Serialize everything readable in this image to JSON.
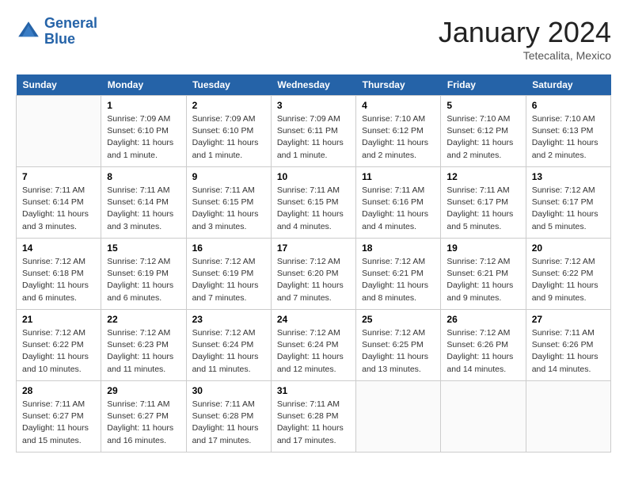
{
  "header": {
    "logo_line1": "General",
    "logo_line2": "Blue",
    "month": "January 2024",
    "location": "Tetecalita, Mexico"
  },
  "days_of_week": [
    "Sunday",
    "Monday",
    "Tuesday",
    "Wednesday",
    "Thursday",
    "Friday",
    "Saturday"
  ],
  "weeks": [
    [
      {
        "day": "",
        "info": ""
      },
      {
        "day": "1",
        "info": "Sunrise: 7:09 AM\nSunset: 6:10 PM\nDaylight: 11 hours\nand 1 minute."
      },
      {
        "day": "2",
        "info": "Sunrise: 7:09 AM\nSunset: 6:10 PM\nDaylight: 11 hours\nand 1 minute."
      },
      {
        "day": "3",
        "info": "Sunrise: 7:09 AM\nSunset: 6:11 PM\nDaylight: 11 hours\nand 1 minute."
      },
      {
        "day": "4",
        "info": "Sunrise: 7:10 AM\nSunset: 6:12 PM\nDaylight: 11 hours\nand 2 minutes."
      },
      {
        "day": "5",
        "info": "Sunrise: 7:10 AM\nSunset: 6:12 PM\nDaylight: 11 hours\nand 2 minutes."
      },
      {
        "day": "6",
        "info": "Sunrise: 7:10 AM\nSunset: 6:13 PM\nDaylight: 11 hours\nand 2 minutes."
      }
    ],
    [
      {
        "day": "7",
        "info": "Sunrise: 7:11 AM\nSunset: 6:14 PM\nDaylight: 11 hours\nand 3 minutes."
      },
      {
        "day": "8",
        "info": "Sunrise: 7:11 AM\nSunset: 6:14 PM\nDaylight: 11 hours\nand 3 minutes."
      },
      {
        "day": "9",
        "info": "Sunrise: 7:11 AM\nSunset: 6:15 PM\nDaylight: 11 hours\nand 3 minutes."
      },
      {
        "day": "10",
        "info": "Sunrise: 7:11 AM\nSunset: 6:15 PM\nDaylight: 11 hours\nand 4 minutes."
      },
      {
        "day": "11",
        "info": "Sunrise: 7:11 AM\nSunset: 6:16 PM\nDaylight: 11 hours\nand 4 minutes."
      },
      {
        "day": "12",
        "info": "Sunrise: 7:11 AM\nSunset: 6:17 PM\nDaylight: 11 hours\nand 5 minutes."
      },
      {
        "day": "13",
        "info": "Sunrise: 7:12 AM\nSunset: 6:17 PM\nDaylight: 11 hours\nand 5 minutes."
      }
    ],
    [
      {
        "day": "14",
        "info": "Sunrise: 7:12 AM\nSunset: 6:18 PM\nDaylight: 11 hours\nand 6 minutes."
      },
      {
        "day": "15",
        "info": "Sunrise: 7:12 AM\nSunset: 6:19 PM\nDaylight: 11 hours\nand 6 minutes."
      },
      {
        "day": "16",
        "info": "Sunrise: 7:12 AM\nSunset: 6:19 PM\nDaylight: 11 hours\nand 7 minutes."
      },
      {
        "day": "17",
        "info": "Sunrise: 7:12 AM\nSunset: 6:20 PM\nDaylight: 11 hours\nand 7 minutes."
      },
      {
        "day": "18",
        "info": "Sunrise: 7:12 AM\nSunset: 6:21 PM\nDaylight: 11 hours\nand 8 minutes."
      },
      {
        "day": "19",
        "info": "Sunrise: 7:12 AM\nSunset: 6:21 PM\nDaylight: 11 hours\nand 9 minutes."
      },
      {
        "day": "20",
        "info": "Sunrise: 7:12 AM\nSunset: 6:22 PM\nDaylight: 11 hours\nand 9 minutes."
      }
    ],
    [
      {
        "day": "21",
        "info": "Sunrise: 7:12 AM\nSunset: 6:22 PM\nDaylight: 11 hours\nand 10 minutes."
      },
      {
        "day": "22",
        "info": "Sunrise: 7:12 AM\nSunset: 6:23 PM\nDaylight: 11 hours\nand 11 minutes."
      },
      {
        "day": "23",
        "info": "Sunrise: 7:12 AM\nSunset: 6:24 PM\nDaylight: 11 hours\nand 11 minutes."
      },
      {
        "day": "24",
        "info": "Sunrise: 7:12 AM\nSunset: 6:24 PM\nDaylight: 11 hours\nand 12 minutes."
      },
      {
        "day": "25",
        "info": "Sunrise: 7:12 AM\nSunset: 6:25 PM\nDaylight: 11 hours\nand 13 minutes."
      },
      {
        "day": "26",
        "info": "Sunrise: 7:12 AM\nSunset: 6:26 PM\nDaylight: 11 hours\nand 14 minutes."
      },
      {
        "day": "27",
        "info": "Sunrise: 7:11 AM\nSunset: 6:26 PM\nDaylight: 11 hours\nand 14 minutes."
      }
    ],
    [
      {
        "day": "28",
        "info": "Sunrise: 7:11 AM\nSunset: 6:27 PM\nDaylight: 11 hours\nand 15 minutes."
      },
      {
        "day": "29",
        "info": "Sunrise: 7:11 AM\nSunset: 6:27 PM\nDaylight: 11 hours\nand 16 minutes."
      },
      {
        "day": "30",
        "info": "Sunrise: 7:11 AM\nSunset: 6:28 PM\nDaylight: 11 hours\nand 17 minutes."
      },
      {
        "day": "31",
        "info": "Sunrise: 7:11 AM\nSunset: 6:28 PM\nDaylight: 11 hours\nand 17 minutes."
      },
      {
        "day": "",
        "info": ""
      },
      {
        "day": "",
        "info": ""
      },
      {
        "day": "",
        "info": ""
      }
    ]
  ]
}
